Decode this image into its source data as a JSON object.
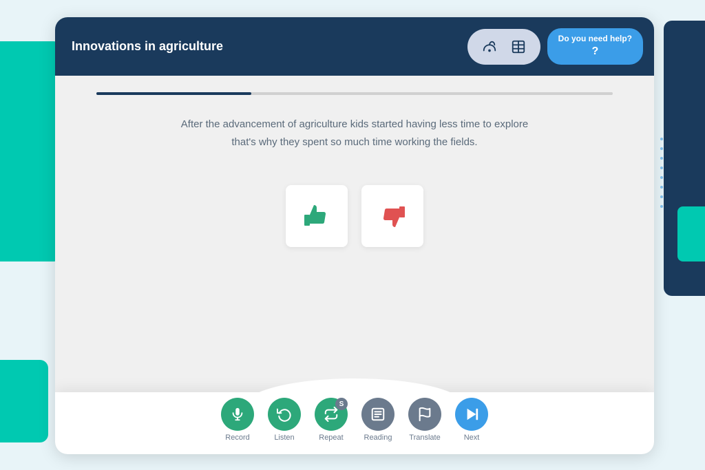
{
  "app": {
    "title": "Innovations in agriculture"
  },
  "header": {
    "title": "Innovations in agriculture",
    "help_label": "Do you need help?",
    "help_mark": "?"
  },
  "progress": {
    "fill_percent": 30
  },
  "passage": {
    "text": "After the advancement of agriculture kids started having less time to explore that's why they spent so much time working the fields."
  },
  "answers": {
    "thumbs_up_label": "👍",
    "thumbs_down_label": "👎"
  },
  "toolbar": {
    "items": [
      {
        "id": "record",
        "label": "Record",
        "icon": "🎤",
        "style": "teal",
        "badge": null
      },
      {
        "id": "listen",
        "label": "Listen",
        "icon": "🔄",
        "style": "teal",
        "badge": null
      },
      {
        "id": "repeat",
        "label": "Repeat",
        "icon": "🔁",
        "style": "teal",
        "badge": "S"
      },
      {
        "id": "reading",
        "label": "Reading",
        "icon": "📖",
        "style": "gray",
        "badge": null
      },
      {
        "id": "translate",
        "label": "Translate",
        "icon": "✂",
        "style": "gray",
        "badge": null
      },
      {
        "id": "next",
        "label": "Next",
        "icon": "⏭",
        "style": "blue",
        "badge": null
      }
    ]
  },
  "icons": {
    "ear": "👂",
    "book": "📖",
    "mic": "🎙",
    "listen_cycle": "↻",
    "repeat_arrows": "⇄",
    "skip_next": "⏭"
  }
}
